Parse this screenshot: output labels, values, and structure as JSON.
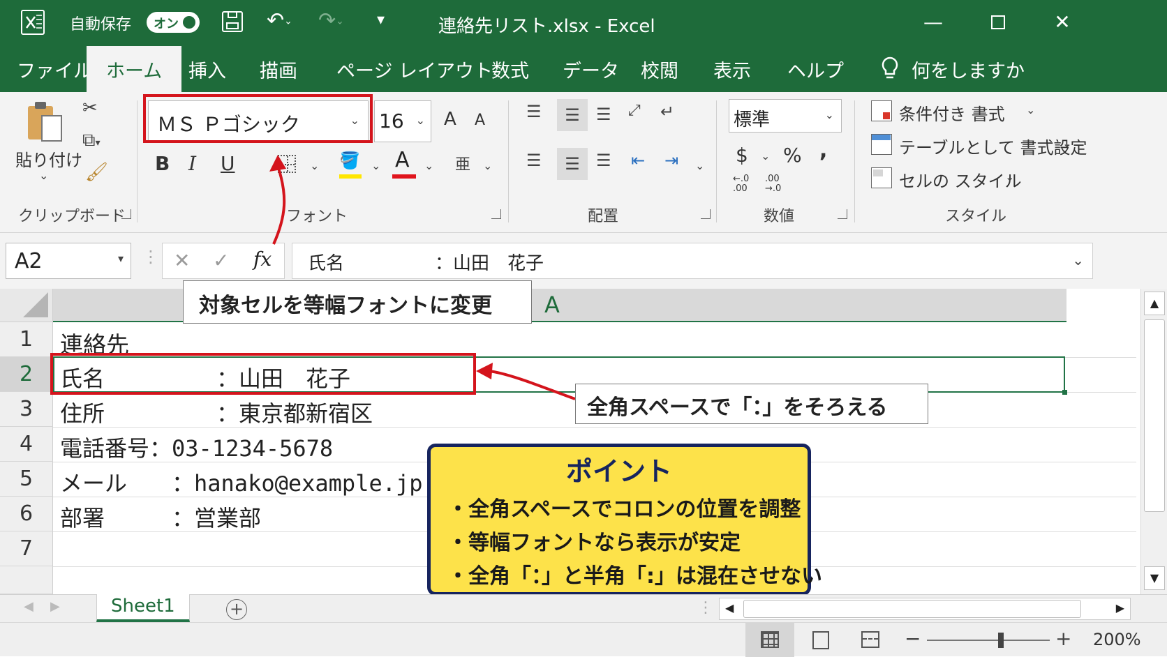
{
  "title_bar": {
    "app_icon": "excel-icon",
    "autosave_label": "自動保存",
    "autosave_toggle": "オン",
    "save_icon": "save-icon",
    "undo_icon": "undo-icon",
    "redo_icon": "redo-icon",
    "customize_icon": "customize-qat-icon",
    "window_title": "連絡先リスト.xlsx  -  Excel"
  },
  "tabs": [
    "ファイル",
    "ホーム",
    "挿入",
    "描画",
    "ページ レイアウト",
    "数式",
    "データ",
    "校閲",
    "表示",
    "ヘルプ"
  ],
  "tell_me": "何をしますか",
  "ribbon": {
    "clipboard": {
      "paste_label": "貼り付け",
      "group_label": "クリップボード"
    },
    "font": {
      "font_name": "ＭＳ Ｐゴシック",
      "font_size": "16",
      "grow": "A",
      "shrink": "A",
      "bold": "B",
      "italic": "I",
      "underline": "U",
      "font_color": "A",
      "group_label": "フォント"
    },
    "alignment": {
      "group_label": "配置"
    },
    "number": {
      "format": "標準",
      "currency": "$",
      "percent": "%",
      "comma": ",",
      "inc_dec_1": "←.0",
      "inc_dec_1b": ".00",
      "inc_dec_2": ".00",
      "inc_dec_2b": "→.0",
      "group_label": "数値"
    },
    "styles": {
      "conditional": "条件付き 書式",
      "as_table": "テーブルとして 書式設定",
      "cell_styles": "セルの スタイル",
      "group_label": "スタイル"
    }
  },
  "formula_bar": {
    "name_box": "A2",
    "fx": "fx",
    "content": "氏名　　　　　：山田　花子"
  },
  "grid": {
    "column_header": "A",
    "rows": [
      {
        "num": "1",
        "text": "連絡先"
      },
      {
        "num": "2",
        "text": "氏名　　　　　：山田　花子"
      },
      {
        "num": "3",
        "text": "住所　　　　　：東京都新宿区"
      },
      {
        "num": "4",
        "text": "電話番号：03-1234-5678"
      },
      {
        "num": "5",
        "text": "メール　　：hanako@example.jp"
      },
      {
        "num": "6",
        "text": "部署　　　：営業部"
      },
      {
        "num": "7",
        "text": ""
      }
    ]
  },
  "annotations": {
    "font_callout": "対象セルを等幅フォントに変更",
    "align_callout": "全角スペースで「：」をそろえる",
    "point_title": "ポイント",
    "point_items": [
      "・全角スペースでコロンの位置を調整",
      "・等幅フォントなら表示が安定",
      "・全角「：」と半角「:」は混在させない"
    ],
    "accent_color": "#d4141c",
    "point_bg": "#fde24a",
    "point_border": "#16245e"
  },
  "sheet_tabs": {
    "active": "Sheet1"
  },
  "status_bar": {
    "zoom": "200%",
    "zoom_level_percent": 200
  }
}
